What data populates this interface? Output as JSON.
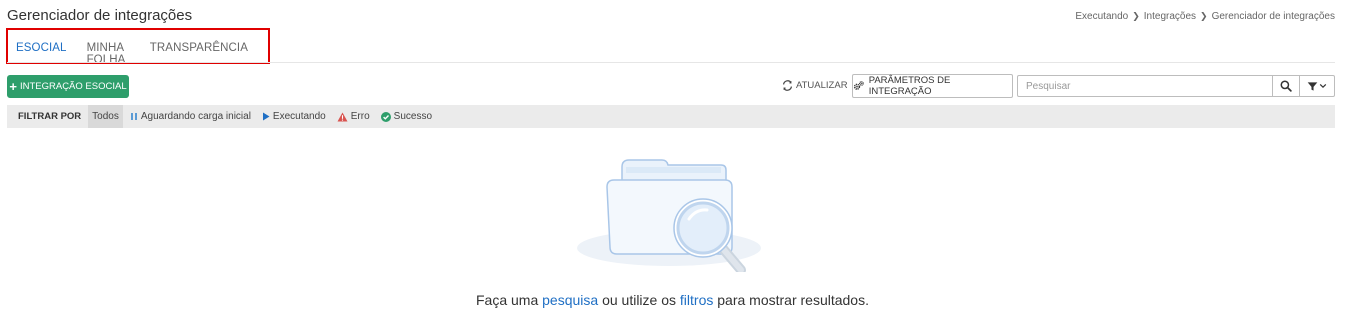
{
  "header": {
    "title": "Gerenciador de integrações",
    "breadcrumb": [
      "Executando",
      "Integrações",
      "Gerenciador de integrações"
    ]
  },
  "tabs": [
    {
      "label": "ESOCIAL",
      "active": true
    },
    {
      "label": "MINHA FOLHA",
      "active": false
    },
    {
      "label": "TRANSPARÊNCIA",
      "active": false
    }
  ],
  "toolbar": {
    "add_label": "INTEGRAÇÃO ESOCIAL",
    "refresh_label": "ATUALIZAR",
    "params_label": "PARÂMETROS DE INTEGRAÇÃO",
    "search_placeholder": "Pesquisar",
    "search_value": ""
  },
  "filter": {
    "label": "FILTRAR POR",
    "options": [
      {
        "label": "Todos",
        "active": true,
        "icon": "none"
      },
      {
        "label": "Aguardando carga inicial",
        "icon": "pause-icon",
        "color": "#5b9bd5"
      },
      {
        "label": "Executando",
        "icon": "play-icon",
        "color": "#1f6fc4"
      },
      {
        "label": "Erro",
        "icon": "warning-icon",
        "color": "#d9534f"
      },
      {
        "label": "Sucesso",
        "icon": "check-circle-icon",
        "color": "#2e9e6b"
      }
    ]
  },
  "empty_state": {
    "prefix": "Faça uma ",
    "link1": "pesquisa",
    "middle": " ou utilize os ",
    "link2": "filtros",
    "suffix": " para mostrar resultados."
  },
  "colors": {
    "accent": "#1f6fc4",
    "primary_button": "#2e9e6b",
    "highlight_box": "#e00000"
  }
}
